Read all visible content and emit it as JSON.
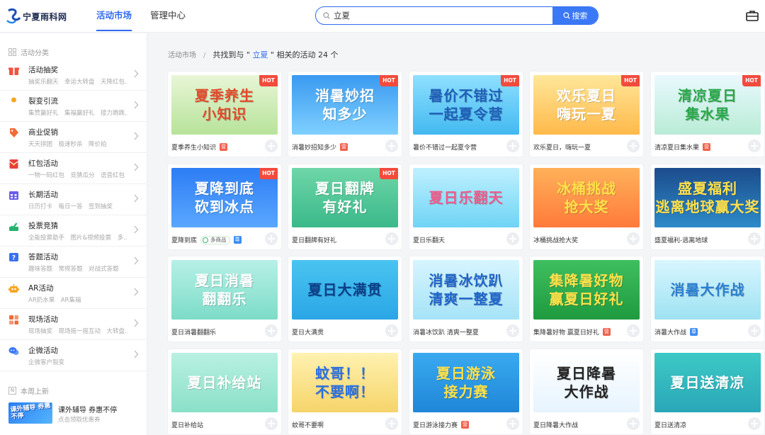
{
  "header": {
    "logo_text": "宁夏雨科网",
    "nav": [
      "活动市场",
      "管理中心"
    ],
    "search_value": "立夏",
    "search_button": "搜索"
  },
  "sidebar": {
    "heading": "活动分类",
    "categories": [
      {
        "title": "活动抽奖",
        "sub": "抽奖乐翻天　幸运大转盘　天降红包...",
        "icon": "gift-icon",
        "color": "#f0533f"
      },
      {
        "title": "裂变引流",
        "sub": "集赞赢好礼　集福赢好礼　接力跑跳...",
        "icon": "user-icon",
        "color": "#f5a623"
      },
      {
        "title": "商业促销",
        "sub": "天天拼团　极速秒杀　降价拍",
        "icon": "tag-icon",
        "color": "#f26b3a"
      },
      {
        "title": "红包活动",
        "sub": "一物一码红包　竞猜瓜分　语音红包",
        "icon": "red-envelope-icon",
        "color": "#e8403a"
      },
      {
        "title": "长期活动",
        "sub": "日历打卡　每日一答　签到抽奖",
        "icon": "calendar-icon",
        "color": "#6a5cf0"
      },
      {
        "title": "投票竞猜",
        "sub": "全能投票助手　图片&视频投票　多...",
        "icon": "vote-icon",
        "color": "#23b26d"
      },
      {
        "title": "答题活动",
        "sub": "趣味答题　常规答题　对战式答题",
        "icon": "question-icon",
        "color": "#3a6ff0"
      },
      {
        "title": "AR活动",
        "sub": "AR扔水果　AR集福",
        "icon": "robot-icon",
        "color": "#f5a623"
      },
      {
        "title": "现场活动",
        "sub": "现场抽奖　现场摇一摇互动　大转盘...",
        "icon": "grid-icon",
        "color": "#f26b3a"
      },
      {
        "title": "企微活动",
        "sub": "企微客户裂变",
        "icon": "chat-icon",
        "color": "#3a78f5"
      }
    ],
    "new_heading": "本周上新",
    "new_label": "N",
    "new_item": {
      "thumb_text": "课外辅导 券惠不停",
      "title": "课外辅导 券惠不停",
      "sub": "点击领取优惠券"
    }
  },
  "breadcrumb": {
    "root": "活动市场",
    "sep": "/",
    "prefix": "共找到与 \" ",
    "keyword": "立夏",
    "suffix": " \" 相关的活动 24 个"
  },
  "badges": {
    "ying": "营",
    "zun": "尊",
    "multi": "多商品",
    "hot": "HOT"
  },
  "cards": [
    {
      "name": "夏季养生小知识",
      "art": "夏季养生\n小知识",
      "hot": true,
      "badge": "ying",
      "bg": "linear-gradient(180deg,#e8f6d6,#b7e39a)",
      "fg": "#e24a2b"
    },
    {
      "name": "消暑妙招知多少",
      "art": "消暑妙招\n知多少",
      "hot": true,
      "badge": "ying",
      "bg": "linear-gradient(180deg,#3a9af0,#7fd0ff)",
      "fg": "#ffffff"
    },
    {
      "name": "暑价不错过一起夏令营",
      "art": "暑价不错过\n一起夏令营",
      "hot": true,
      "badge": "",
      "bg": "linear-gradient(180deg,#8fe0ff,#43b9f0)",
      "fg": "#1f5fb8"
    },
    {
      "name": "欢乐夏日，嗨玩一夏",
      "art": "欢乐夏日\n嗨玩一夏",
      "hot": true,
      "badge": "",
      "bg": "linear-gradient(180deg,#ffe79a,#ffb94a)",
      "fg": "#ffffff"
    },
    {
      "name": "清凉夏日集水果",
      "art": "清凉夏日\n集水果",
      "hot": true,
      "badge": "ying",
      "bg": "linear-gradient(180deg,#eaf9ff,#b9ecd6)",
      "fg": "#2aa84a"
    },
    {
      "name": "夏降到底",
      "art": "夏降到底\n砍到冰点",
      "hot": true,
      "badge": "zun",
      "multi": true,
      "bg": "linear-gradient(180deg,#2d7df5,#5aa7ff)",
      "fg": "#ffffff"
    },
    {
      "name": "夏日翻牌有好礼",
      "art": "夏日翻牌\n有好礼",
      "hot": true,
      "badge": "",
      "bg": "linear-gradient(180deg,#6fd6a8,#3ab98a)",
      "fg": "#ffffff"
    },
    {
      "name": "夏日乐翻天",
      "art": "夏日乐翻天",
      "hot": false,
      "badge": "",
      "bg": "linear-gradient(180deg,#bff0ff,#6fd4f5)",
      "fg": "#f05a8a"
    },
    {
      "name": "冰桶挑战抢大奖",
      "art": "冰桶挑战\n抢大奖",
      "hot": false,
      "badge": "",
      "bg": "linear-gradient(180deg,#ffb15a,#ff7a3a)",
      "fg": "#ffe14a"
    },
    {
      "name": "盛夏福利-逃离地球",
      "art": "盛夏福利\n逃离地球赢大奖",
      "hot": false,
      "badge": "",
      "bg": "linear-gradient(180deg,#1c4c8c,#2d8bc9)",
      "fg": "#ffe14a"
    },
    {
      "name": "夏日消暑翻翻乐",
      "art": "夏日消暑\n翻翻乐",
      "hot": false,
      "badge": "",
      "bg": "linear-gradient(180deg,#b7f0e6,#7cdcc8)",
      "fg": "#ffffff"
    },
    {
      "name": "夏日大满贯",
      "art": "夏日大满贯",
      "hot": false,
      "badge": "",
      "bg": "linear-gradient(180deg,#49c4f0,#2aa6e6)",
      "fg": "#0c3f8a"
    },
    {
      "name": "消暑冰饮趴 清爽一整夏",
      "art": "消暑冰饮趴\n清爽一整夏",
      "hot": false,
      "badge": "",
      "bg": "linear-gradient(180deg,#d6f5ff,#a5e3f7)",
      "fg": "#1f64c8"
    },
    {
      "name": "集降暑好物 赢夏日好礼",
      "art": "集降暑好物\n赢夏日好礼",
      "hot": false,
      "badge": "ying",
      "bg": "linear-gradient(180deg,#3fbf5f,#1f9a3f)",
      "fg": "#ffe14a"
    },
    {
      "name": "消暑大作战",
      "art": "消暑大作战",
      "hot": false,
      "badge": "zun",
      "bg": "linear-gradient(180deg,#d8f6ff,#9ee2f2)",
      "fg": "#2b7fd0"
    },
    {
      "name": "夏日补给站",
      "art": "夏日补给站",
      "hot": false,
      "badge": "",
      "bg": "linear-gradient(180deg,#b9f0e1,#8ae0c8)",
      "fg": "#ffffff"
    },
    {
      "name": "蚊哥不要啊",
      "art": "蚊哥！！\n不要啊！",
      "hot": false,
      "badge": "",
      "bg": "linear-gradient(180deg,#fff2b0,#f6d46a)",
      "fg": "#2a6fe0"
    },
    {
      "name": "夏日游泳接力赛",
      "art": "夏日游泳\n接力赛",
      "hot": false,
      "badge": "ying",
      "bg": "linear-gradient(180deg,#3aaaf0,#1f86d8)",
      "fg": "#ffe14a"
    },
    {
      "name": "夏日降暑大作战",
      "art": "夏日降暑\n大作战",
      "hot": false,
      "badge": "",
      "bg": "linear-gradient(180deg,#ffffff,#e6f4ff)",
      "fg": "#222222"
    },
    {
      "name": "夏日送清凉",
      "art": "夏日送清凉",
      "hot": false,
      "badge": "",
      "bg": "linear-gradient(180deg,#3dc9c5,#2aa7b8)",
      "fg": "#ffffff"
    }
  ]
}
